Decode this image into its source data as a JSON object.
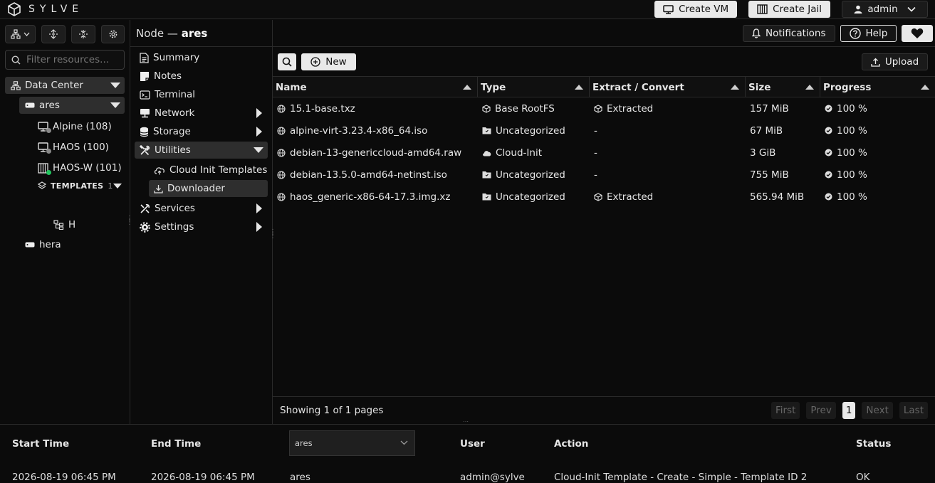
{
  "app": {
    "name": "SYLVE"
  },
  "topbar": {
    "create_vm": "Create VM",
    "create_jail": "Create Jail",
    "user": "admin"
  },
  "sidebar": {
    "filter_placeholder": "Filter resources...",
    "tree": {
      "datacenter": "Data Center",
      "node_ares": "ares",
      "vm_alpine": "Alpine (108)",
      "vm_haos": "HAOS (100)",
      "jail_haosw": "HAOS-W (101)",
      "templates_label": "TEMPLATES",
      "templates_count": "1",
      "template_h": "H",
      "node_hera": "hera"
    }
  },
  "header": {
    "title_prefix": "Node —",
    "title_node": "ares",
    "notifications": "Notifications",
    "help": "Help"
  },
  "menu": {
    "summary": "Summary",
    "notes": "Notes",
    "terminal": "Terminal",
    "network": "Network",
    "storage": "Storage",
    "utilities": "Utilities",
    "cloud_init_templates": "Cloud Init Templates",
    "downloader": "Downloader",
    "services": "Services",
    "settings": "Settings"
  },
  "toolbar": {
    "new": "New",
    "upload": "Upload"
  },
  "table": {
    "columns": [
      "Name",
      "Type",
      "Extract / Convert",
      "Size",
      "Progress"
    ],
    "rows": [
      {
        "name": "15.1-base.txz",
        "type": "Base RootFS",
        "type_icon": "box-icon",
        "extract": "Extracted",
        "size": "157 MiB",
        "progress": "100 %"
      },
      {
        "name": "alpine-virt-3.23.4-x86_64.iso",
        "type": "Uncategorized",
        "type_icon": "folder-icon",
        "extract": "-",
        "size": "67 MiB",
        "progress": "100 %"
      },
      {
        "name": "debian-13-genericcloud-amd64.raw",
        "type": "Cloud-Init",
        "type_icon": "cloud-icon",
        "extract": "-",
        "size": "3 GiB",
        "progress": "100 %"
      },
      {
        "name": "debian-13.5.0-amd64-netinst.iso",
        "type": "Uncategorized",
        "type_icon": "folder-icon",
        "extract": "-",
        "size": "755 MiB",
        "progress": "100 %"
      },
      {
        "name": "haos_generic-x86-64-17.3.img.xz",
        "type": "Uncategorized",
        "type_icon": "folder-icon",
        "extract": "Extracted",
        "size": "565.94 MiB",
        "progress": "100 %"
      }
    ]
  },
  "pagination": {
    "showing": "Showing 1 of 1 pages",
    "first": "First",
    "prev": "Prev",
    "page": "1",
    "next": "Next",
    "last": "Last"
  },
  "tasks": {
    "headers": {
      "start": "Start Time",
      "end": "End Time",
      "node_select": "ares",
      "user": "User",
      "action": "Action",
      "status": "Status"
    },
    "row": {
      "start": "2026-08-19 06:45 PM",
      "end": "2026-08-19 06:45 PM",
      "node": "ares",
      "user": "admin@sylve",
      "action": "Cloud-Init Template - Create - Simple - Template ID 2",
      "status": "OK"
    }
  },
  "colors": {
    "accent_selected": "#2e2e2e",
    "status_green": "#22c55e",
    "status_grey": "#888888"
  }
}
